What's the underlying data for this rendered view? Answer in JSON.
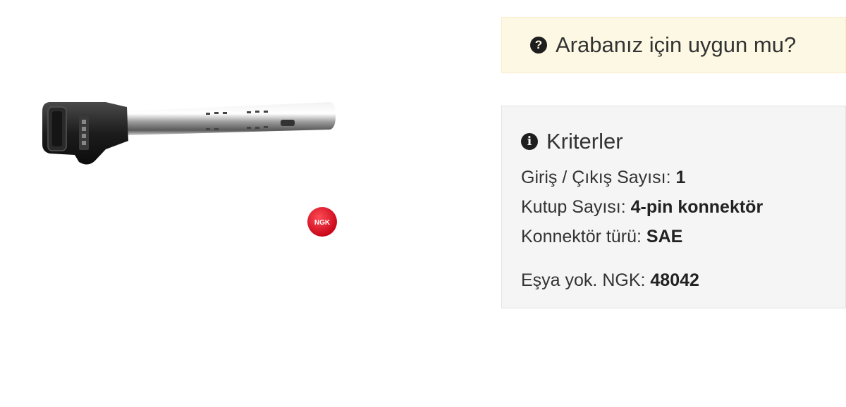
{
  "fitment": {
    "question_icon": "question-circle-icon",
    "text": "Arabanız için uygun mu?"
  },
  "product_image": {
    "logo_text": "NGK",
    "colors": {
      "logo_red": "#e2001a"
    }
  },
  "criteria": {
    "icon": "info-circle-icon",
    "title": "Kriterler",
    "items": [
      {
        "label": "Giriş / Çıkış Sayısı:",
        "value": "1"
      },
      {
        "label": "Kutup Sayısı:",
        "value": "4-pin konnektör"
      },
      {
        "label": "Konnektör türü:",
        "value": "SAE"
      }
    ],
    "reference": {
      "label": "Eşya yok. NGK:",
      "value": "48042"
    }
  },
  "colors": {
    "banner_bg": "#fcf8e3",
    "panel_bg": "#f5f5f5",
    "text": "#333333"
  }
}
